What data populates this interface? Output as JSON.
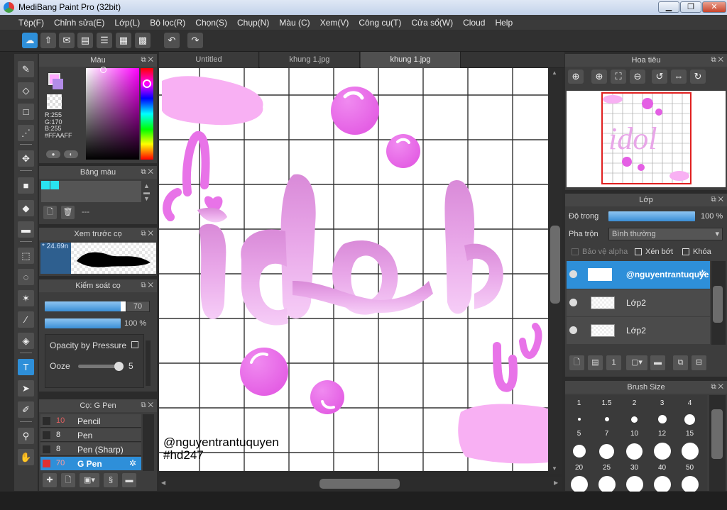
{
  "window": {
    "title": "MediBang Paint Pro (32bit)",
    "minimize": "▁",
    "restore": "❐",
    "close": "✕"
  },
  "menu": [
    "Tệp(F)",
    "Chỉnh sửa(E)",
    "Lớp(L)",
    "Bộ lọc(R)",
    "Chọn(S)",
    "Chụp(N)",
    "Màu (C)",
    "Xem(V)",
    "Công cụ(T)",
    "Cửa sổ(W)",
    "Cloud",
    "Help"
  ],
  "tabs": [
    "Untitled",
    "khung 1.jpg",
    "khung 1.jpg"
  ],
  "color_panel": {
    "title": "Màu",
    "r": "R:255",
    "g": "G:170",
    "b": "B:255",
    "hex": "#FFAAFF",
    "primary_color": "#ffaaff",
    "secondary_color": "#b38ce8"
  },
  "palette_panel": {
    "title": "Bảng màu",
    "swatch_color": "#29e3f0",
    "name": "---"
  },
  "brush_preview_panel": {
    "title": "Xem trước cọ",
    "size": "* 24.69n"
  },
  "brush_control_panel": {
    "title": "Kiểm soát cọ",
    "size_value": "70",
    "opacity_value": "100 %",
    "opacity_by_pressure": "Opacity by Pressure",
    "ooze_label": "Ooze",
    "ooze_value": "5"
  },
  "brush_list_panel": {
    "title": "Cọ: G Pen",
    "items": [
      {
        "size": "10",
        "name": "Pencil"
      },
      {
        "size": "8",
        "name": "Pen"
      },
      {
        "size": "8",
        "name": "Pen (Sharp)"
      },
      {
        "size": "70",
        "name": "G Pen"
      }
    ]
  },
  "canvas": {
    "word": "idol",
    "credit_line1": "@nguyentrantuquyen",
    "credit_line2": "#hd247"
  },
  "navigator_panel": {
    "title": "Hoa tiêu"
  },
  "layer_panel": {
    "title": "Lớp",
    "opacity_label": "Độ trong",
    "opacity_value": "100 %",
    "blend_label": "Pha trộn",
    "blend_value": "Bình thường",
    "protect_alpha": "Bảo vệ alpha",
    "clipping": "Xén bớt",
    "lock": "Khóa",
    "layers": [
      "@nguyentrantuquyen",
      "Lớp2",
      "Lớp2"
    ]
  },
  "brush_size_panel": {
    "title": "Brush Size",
    "sizes": [
      "1",
      "1.5",
      "2",
      "3",
      "4",
      "5",
      "7",
      "10",
      "12",
      "15",
      "20",
      "25",
      "30",
      "40",
      "50"
    ]
  }
}
